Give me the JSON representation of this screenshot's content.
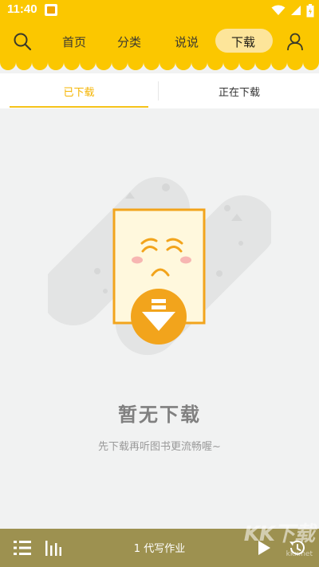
{
  "status_bar": {
    "time": "11:40",
    "icons": [
      "notification-icon",
      "wifi-icon",
      "signal-icon",
      "battery-icon"
    ]
  },
  "top_nav": {
    "tabs": [
      {
        "label": "首页",
        "active": false
      },
      {
        "label": "分类",
        "active": false
      },
      {
        "label": "说说",
        "active": false
      },
      {
        "label": "下载",
        "active": true
      }
    ],
    "icons": [
      "search-icon",
      "user-icon"
    ]
  },
  "sub_tabs": [
    {
      "label": "已下载",
      "active": true
    },
    {
      "label": "正在下载",
      "active": false
    }
  ],
  "empty_state": {
    "title": "暂无下载",
    "subtitle": "先下载再听图书更流畅喔~"
  },
  "player": {
    "track_title": "1 代写作业",
    "icons": [
      "playlist-icon",
      "equalizer-icon",
      "play-icon",
      "history-icon"
    ]
  },
  "watermark": {
    "text": "KK下载",
    "url": "kkx.net"
  },
  "colors": {
    "brand_yellow": "#fbc700",
    "active_tab": "#f5b400",
    "player_bar": "#9d9150",
    "background": "#f1f2f2"
  }
}
